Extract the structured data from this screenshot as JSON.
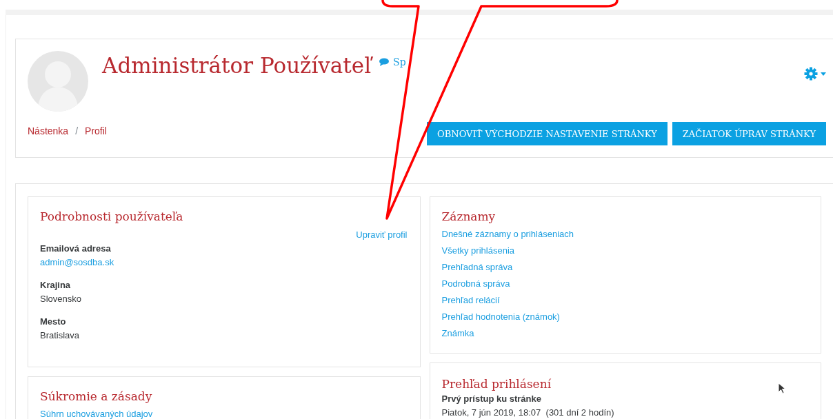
{
  "header": {
    "name": "Administrátor Používateľ",
    "message_link": "Sp",
    "breadcrumb": [
      "Nástenka",
      "Profil"
    ],
    "breadcrumb_separator": "/",
    "buttons": [
      "OBNOVIŤ VÝCHODZIE NASTAVENIE STRÁNKY",
      "ZAČIATOK ÚPRAV STRÁNKY"
    ]
  },
  "user_details": {
    "title": "Podrobnosti používateľa",
    "edit_link": "Upraviť profil",
    "fields": [
      {
        "label": "Emailová adresa",
        "value": "admin@sosdba.sk",
        "kind": "link"
      },
      {
        "label": "Krajina",
        "value": "Slovensko",
        "kind": "text"
      },
      {
        "label": "Mesto",
        "value": "Bratislava",
        "kind": "text"
      }
    ]
  },
  "privacy": {
    "title": "Súkromie a zásady",
    "links": [
      "Súhrn uchovávaných údajov"
    ]
  },
  "reports": {
    "title": "Záznamy",
    "links": [
      "Dnešné záznamy o prihláseniach",
      "Všetky prihlásenia",
      "Prehľadná správa",
      "Podrobná správa",
      "Prehľad relácií",
      "Prehľad hodnotenia (známok)",
      "Známka"
    ]
  },
  "login_overview": {
    "title": "Prehľad prihlásení",
    "fields": [
      {
        "label": "Prvý prístup ku stránke",
        "value": "Piatok, 7 jún 2019, 18:07  (301 dní 2 hodín)"
      }
    ]
  }
}
